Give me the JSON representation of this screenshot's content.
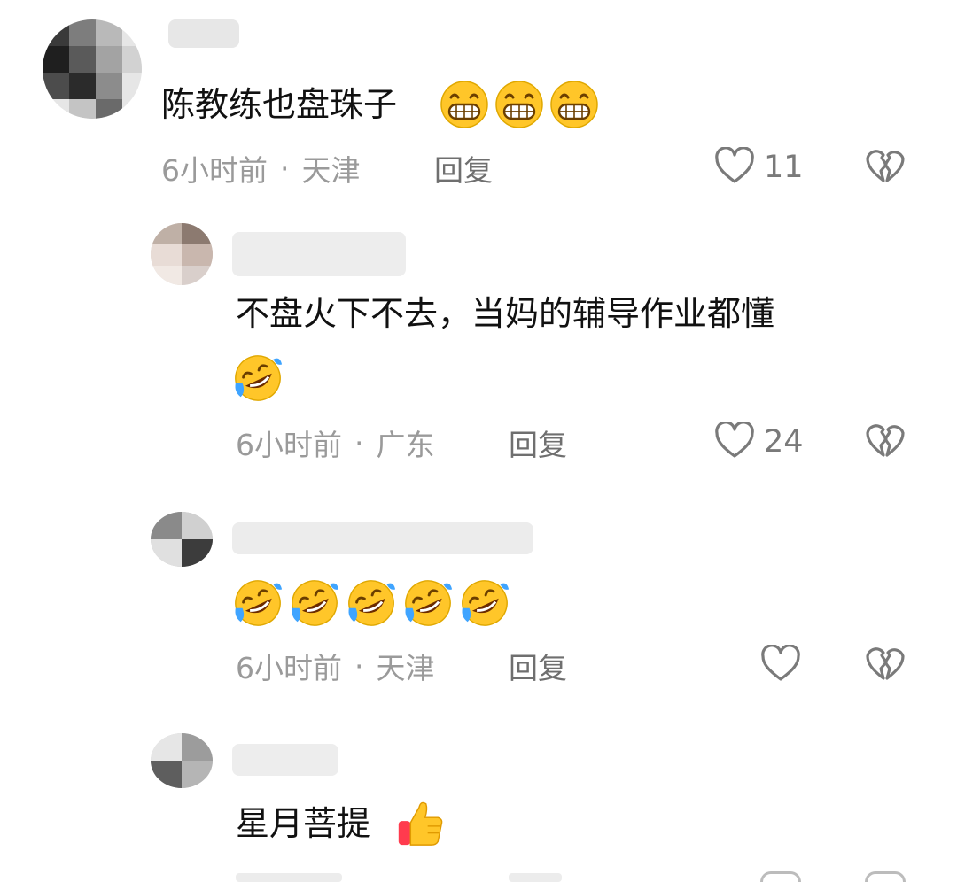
{
  "colors": {
    "text": "#111111",
    "meta": "#9a9a9a",
    "icon_stroke": "#7a7a7a",
    "emoji_yellow": "#ffc629",
    "emoji_tear": "#3fa4ff"
  },
  "comments": [
    {
      "text": "陈教练也盘珠子",
      "emoji": "grinning-face-emoji",
      "emoji_count": 3,
      "time": "6小时前",
      "dot": "·",
      "location": "天津",
      "reply": "回复",
      "likes": "11"
    },
    {
      "text": "不盘火下不去，当妈的辅导作业都懂",
      "emoji": "rolling-on-floor-laughing-emoji",
      "emoji_count": 1,
      "time": "6小时前",
      "dot": "·",
      "location": "广东",
      "reply": "回复",
      "likes": "24"
    },
    {
      "text": "",
      "emoji": "rolling-on-floor-laughing-emoji",
      "emoji_count": 5,
      "time": "6小时前",
      "dot": "·",
      "location": "天津",
      "reply": "回复",
      "likes": ""
    },
    {
      "text": "星月菩提",
      "emoji": "thumbs-up-emoji",
      "emoji_count": 1
    }
  ],
  "icons": {
    "like": "heart-outline-icon",
    "dislike": "broken-heart-icon"
  }
}
